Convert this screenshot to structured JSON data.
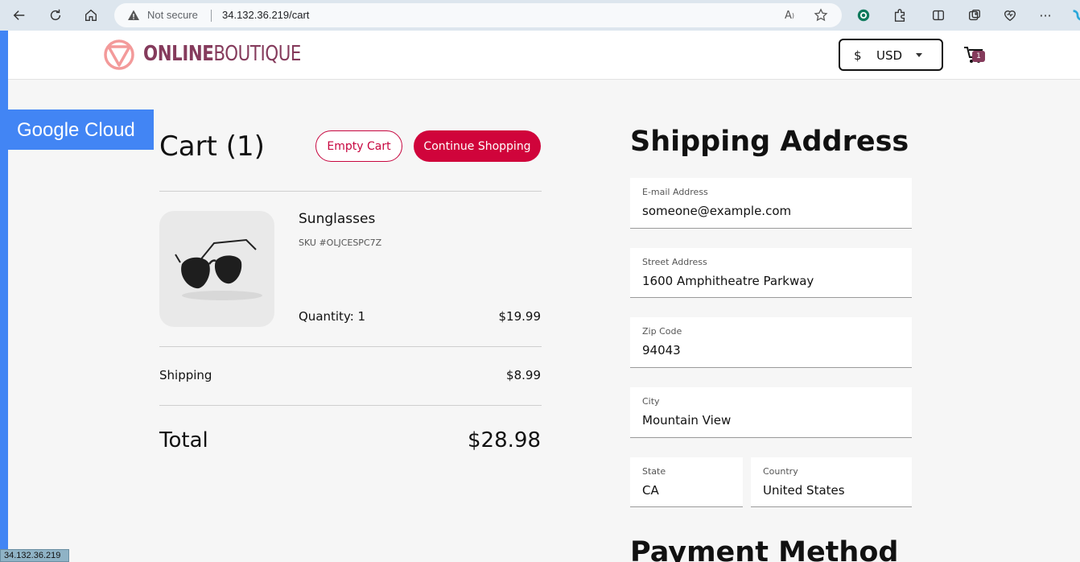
{
  "browser": {
    "security_label": "Not secure",
    "url": "34.132.36.219/cart",
    "status_url": "34.132.36.219"
  },
  "header": {
    "logo_bold": "ONLINE",
    "logo_thin": "BOUTIQUE",
    "currency_symbol": "$",
    "currency_code": "USD",
    "cart_count": "1"
  },
  "banner": {
    "label": "Google Cloud"
  },
  "cart": {
    "title": "Cart (1)",
    "empty_label": "Empty Cart",
    "continue_label": "Continue Shopping",
    "items": [
      {
        "name": "Sunglasses",
        "sku": "SKU #OLJCESPC7Z",
        "quantity": "Quantity: 1",
        "price": "$19.99"
      }
    ],
    "shipping_label": "Shipping",
    "shipping_value": "$8.99",
    "total_label": "Total",
    "total_value": "$28.98"
  },
  "shipping": {
    "title": "Shipping Address",
    "email": {
      "label": "E-mail Address",
      "value": "someone@example.com"
    },
    "street": {
      "label": "Street Address",
      "value": "1600 Amphitheatre Parkway"
    },
    "zip": {
      "label": "Zip Code",
      "value": "94043"
    },
    "city": {
      "label": "City",
      "value": "Mountain View"
    },
    "state": {
      "label": "State",
      "value": "CA"
    },
    "country": {
      "label": "Country",
      "value": "United States"
    }
  },
  "payment": {
    "title": "Payment Method"
  },
  "colors": {
    "accent": "#d0043b",
    "brand": "#853b5c",
    "banner": "#4285f4"
  }
}
